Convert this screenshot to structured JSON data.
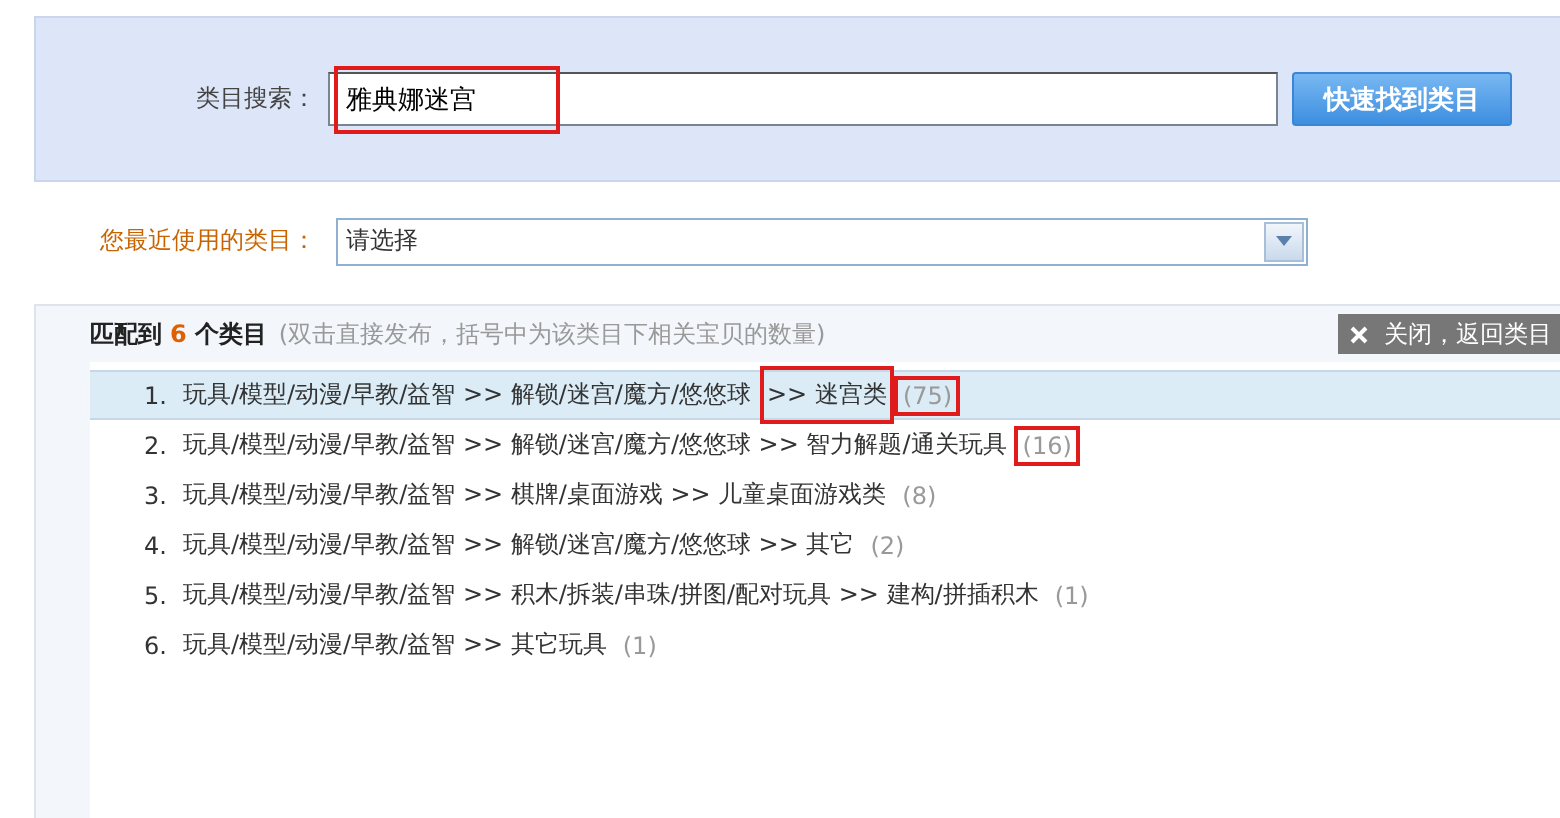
{
  "search": {
    "label": "类目搜索：",
    "value": "雅典娜迷宫",
    "annotated": true,
    "button": "快速找到类目"
  },
  "recent": {
    "label": "您最近使用的类目：",
    "value": "请选择"
  },
  "results": {
    "prefix": "匹配到",
    "count": "6",
    "suffix": "个类目",
    "note": "(双击直接发布，括号中为该类目下相关宝贝的数量)",
    "close": "关闭，返回类目",
    "rows": [
      {
        "index": "1.",
        "path": "玩具/模型/动漫/早教/益智 >> 解锁/迷宫/魔方/悠悠球",
        "marked_tail": ">> 迷宫类",
        "count": "(75)",
        "count_marked": true,
        "selected": true
      },
      {
        "index": "2.",
        "path": "玩具/模型/动漫/早教/益智 >> 解锁/迷宫/魔方/悠悠球 >> 智力解题/通关玩具",
        "count": "(16)",
        "count_marked": true,
        "selected": false
      },
      {
        "index": "3.",
        "path": "玩具/模型/动漫/早教/益智 >> 棋牌/桌面游戏 >> 儿童桌面游戏类",
        "count": "(8)",
        "count_marked": false,
        "selected": false
      },
      {
        "index": "4.",
        "path": "玩具/模型/动漫/早教/益智 >> 解锁/迷宫/魔方/悠悠球 >> 其它",
        "count": "(2)",
        "count_marked": false,
        "selected": false
      },
      {
        "index": "5.",
        "path": "玩具/模型/动漫/早教/益智 >> 积木/拆装/串珠/拼图/配对玩具 >> 建构/拼插积木",
        "count": "(1)",
        "count_marked": false,
        "selected": false
      },
      {
        "index": "6.",
        "path": "玩具/模型/动漫/早教/益智 >> 其它玩具",
        "count": "(1)",
        "count_marked": false,
        "selected": false
      }
    ]
  }
}
